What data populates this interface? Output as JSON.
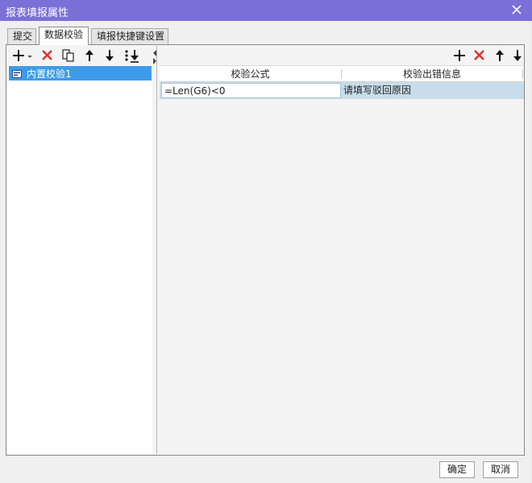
{
  "window": {
    "title": "报表填报属性"
  },
  "tabs": [
    {
      "label": "提交",
      "active": false
    },
    {
      "label": "数据校验",
      "active": true
    },
    {
      "label": "填报快捷键设置",
      "active": false
    }
  ],
  "left_toolbar": {
    "icons": [
      "add-icon",
      "dropdown-arrow-icon",
      "delete-icon",
      "copy-icon",
      "move-up-icon",
      "move-down-icon",
      "move-bottom-icon"
    ]
  },
  "tree": {
    "items": [
      {
        "label": "内置校验1",
        "selected": true
      }
    ]
  },
  "right_toolbar": {
    "icons": [
      "add-icon",
      "delete-icon",
      "move-up-icon",
      "move-down-icon"
    ]
  },
  "grid": {
    "columns": [
      "校验公式",
      "校验出错信息"
    ],
    "rows": [
      {
        "formula": "=Len(G6)<0",
        "message": "请填写驳回原因"
      }
    ]
  },
  "footer": {
    "ok_label": "确定",
    "cancel_label": "取消"
  },
  "colors": {
    "titlebar": "#7b6fd8",
    "selection": "#3d9be9",
    "row_highlight": "#c9dce9",
    "delete_red": "#e0302a"
  }
}
